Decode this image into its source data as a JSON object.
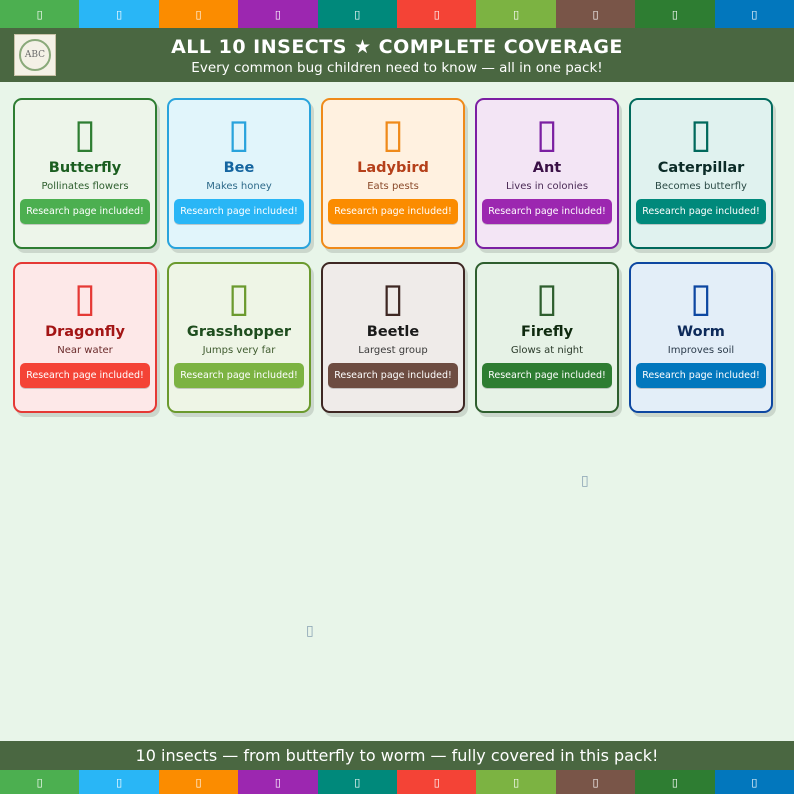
{
  "strip_segments": [
    {
      "icon": "butterfly-icon",
      "glyph": "▯",
      "color": "#4caf50"
    },
    {
      "icon": "bee-icon",
      "glyph": "▯",
      "color": "#29b6f6"
    },
    {
      "icon": "ladybird-icon",
      "glyph": "▯",
      "color": "#fb8c00"
    },
    {
      "icon": "ant-icon",
      "glyph": "▯",
      "color": "#9c27b0"
    },
    {
      "icon": "caterpillar-icon",
      "glyph": "▯",
      "color": "#00897b"
    },
    {
      "icon": "dragonfly-icon",
      "glyph": "▯",
      "color": "#f44336"
    },
    {
      "icon": "grasshopper-icon",
      "glyph": "▯",
      "color": "#7cb342"
    },
    {
      "icon": "beetle-icon",
      "glyph": "▯",
      "color": "#795548"
    },
    {
      "icon": "firefly-icon",
      "glyph": "▯",
      "color": "#2e7d32"
    },
    {
      "icon": "worm-icon",
      "glyph": "▯",
      "color": "#0277bd"
    }
  ],
  "header": {
    "logo_text": "ABC",
    "title": "ALL 10 INSECTS  ★  COMPLETE COVERAGE",
    "subtitle": "Every common bug children need to know — all in one pack!"
  },
  "cards": [
    {
      "name": "Butterfly",
      "fact": "Pollinates flowers",
      "button": "Research page included!",
      "glyph": "▯",
      "icon": "butterfly-icon",
      "accent": "#2e7d32",
      "bg": "#edf5ea",
      "btn": "#4caf50",
      "name_color": "#1b5e20",
      "fact_color": "#2e5e2e"
    },
    {
      "name": "Bee",
      "fact": "Makes honey",
      "button": "Research page included!",
      "glyph": "▯",
      "icon": "bee-icon",
      "accent": "#29a3dc",
      "bg": "#e1f5fb",
      "btn": "#29b6f6",
      "name_color": "#1565a0",
      "fact_color": "#2e6a8a"
    },
    {
      "name": "Ladybird",
      "fact": "Eats pests",
      "button": "Research page included!",
      "glyph": "▯",
      "icon": "ladybird-icon",
      "accent": "#ef8a1a",
      "bg": "#fff1e0",
      "btn": "#fb8c00",
      "name_color": "#b5401a",
      "fact_color": "#8a4a2a"
    },
    {
      "name": "Ant",
      "fact": "Lives in colonies",
      "button": "Research page included!",
      "glyph": "▯",
      "icon": "ant-icon",
      "accent": "#7b1fa2",
      "bg": "#f3e5f5",
      "btn": "#9c27b0",
      "name_color": "#3a1046",
      "fact_color": "#4a2a55"
    },
    {
      "name": "Caterpillar",
      "fact": "Becomes butterfly",
      "button": "Research page included!",
      "glyph": "▯",
      "icon": "caterpillar-icon",
      "accent": "#00695c",
      "bg": "#e0f2ef",
      "btn": "#00897b",
      "name_color": "#0b2b27",
      "fact_color": "#2a4a45"
    },
    {
      "name": "Dragonfly",
      "fact": "Near water",
      "button": "Research page included!",
      "glyph": "▯",
      "icon": "dragonfly-icon",
      "accent": "#e53935",
      "bg": "#fde8e8",
      "btn": "#f44336",
      "name_color": "#a31515",
      "fact_color": "#6a2a2a"
    },
    {
      "name": "Grasshopper",
      "fact": "Jumps very far",
      "button": "Research page included!",
      "glyph": "▯",
      "icon": "grasshopper-icon",
      "accent": "#6b9a2e",
      "bg": "#eef5e6",
      "btn": "#7cb342",
      "name_color": "#1e4d1e",
      "fact_color": "#3e5a2e"
    },
    {
      "name": "Beetle",
      "fact": "Largest group",
      "button": "Research page included!",
      "glyph": "▯",
      "icon": "beetle-icon",
      "accent": "#3e2723",
      "bg": "#efebe9",
      "btn": "#6d4c41",
      "name_color": "#1a1a1a",
      "fact_color": "#3a3a3a"
    },
    {
      "name": "Firefly",
      "fact": "Glows at night",
      "button": "Research page included!",
      "glyph": "▯",
      "icon": "firefly-icon",
      "accent": "#2e5e2e",
      "bg": "#e6f2e6",
      "btn": "#2e7d32",
      "name_color": "#0f2a0f",
      "fact_color": "#2a3a2a"
    },
    {
      "name": "Worm",
      "fact": "Improves soil",
      "button": "Research page included!",
      "glyph": "▯",
      "icon": "worm-icon",
      "accent": "#0d47a1",
      "bg": "#e3eef8",
      "btn": "#0277bd",
      "name_color": "#0d2a5a",
      "fact_color": "#2a3a4a"
    }
  ],
  "decorations": [
    {
      "icon": "small-bug-icon",
      "glyph": "▯"
    },
    {
      "icon": "small-bug-icon",
      "glyph": "▯"
    }
  ],
  "footer": {
    "text": "10 insects — from butterfly to worm — fully covered in this pack!"
  }
}
